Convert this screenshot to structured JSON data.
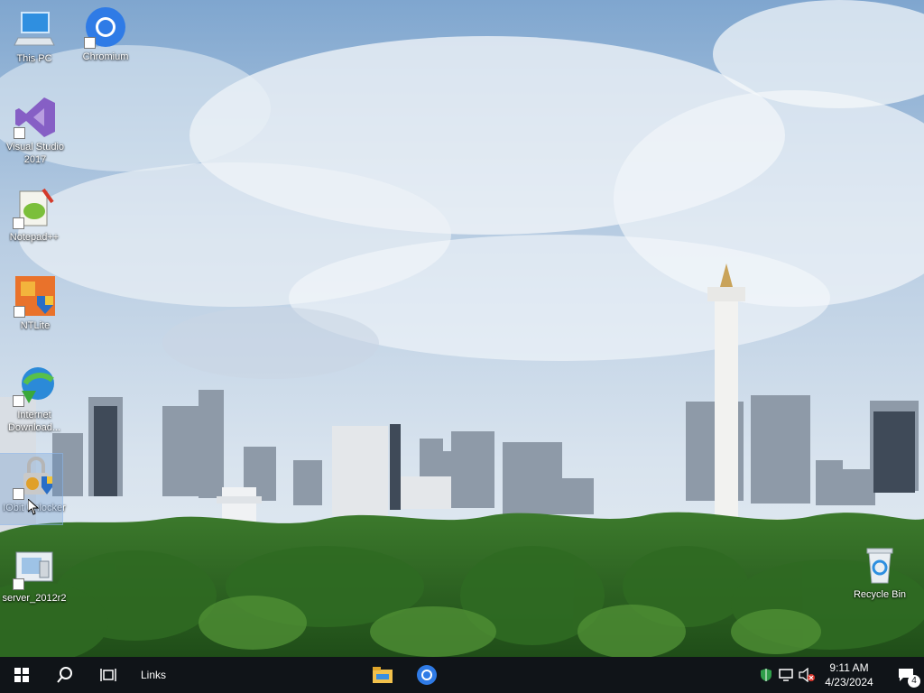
{
  "desktop": {
    "icons": [
      {
        "id": "this-pc",
        "label": "This PC"
      },
      {
        "id": "chromium",
        "label": "Chromium"
      },
      {
        "id": "visual-studio",
        "label": "Visual Studio 2017"
      },
      {
        "id": "notepadpp",
        "label": "Notepad++"
      },
      {
        "id": "ntlite",
        "label": "NTLite"
      },
      {
        "id": "idm",
        "label": "Internet Download..."
      },
      {
        "id": "unlocker",
        "label": "IObit Unlocker"
      },
      {
        "id": "server-2012r2",
        "label": "server_2012r2"
      },
      {
        "id": "recycle-bin",
        "label": "Recycle Bin"
      }
    ]
  },
  "taskbar": {
    "links_label": "Links",
    "pinned": [
      {
        "name": "file-explorer-icon"
      },
      {
        "name": "chromium-icon"
      }
    ],
    "tray": {
      "time": "9:11 AM",
      "date": "4/23/2024",
      "notification_count": "4"
    }
  },
  "colors": {
    "taskbar": "#101418",
    "chromium_blue": "#2f7be6"
  }
}
